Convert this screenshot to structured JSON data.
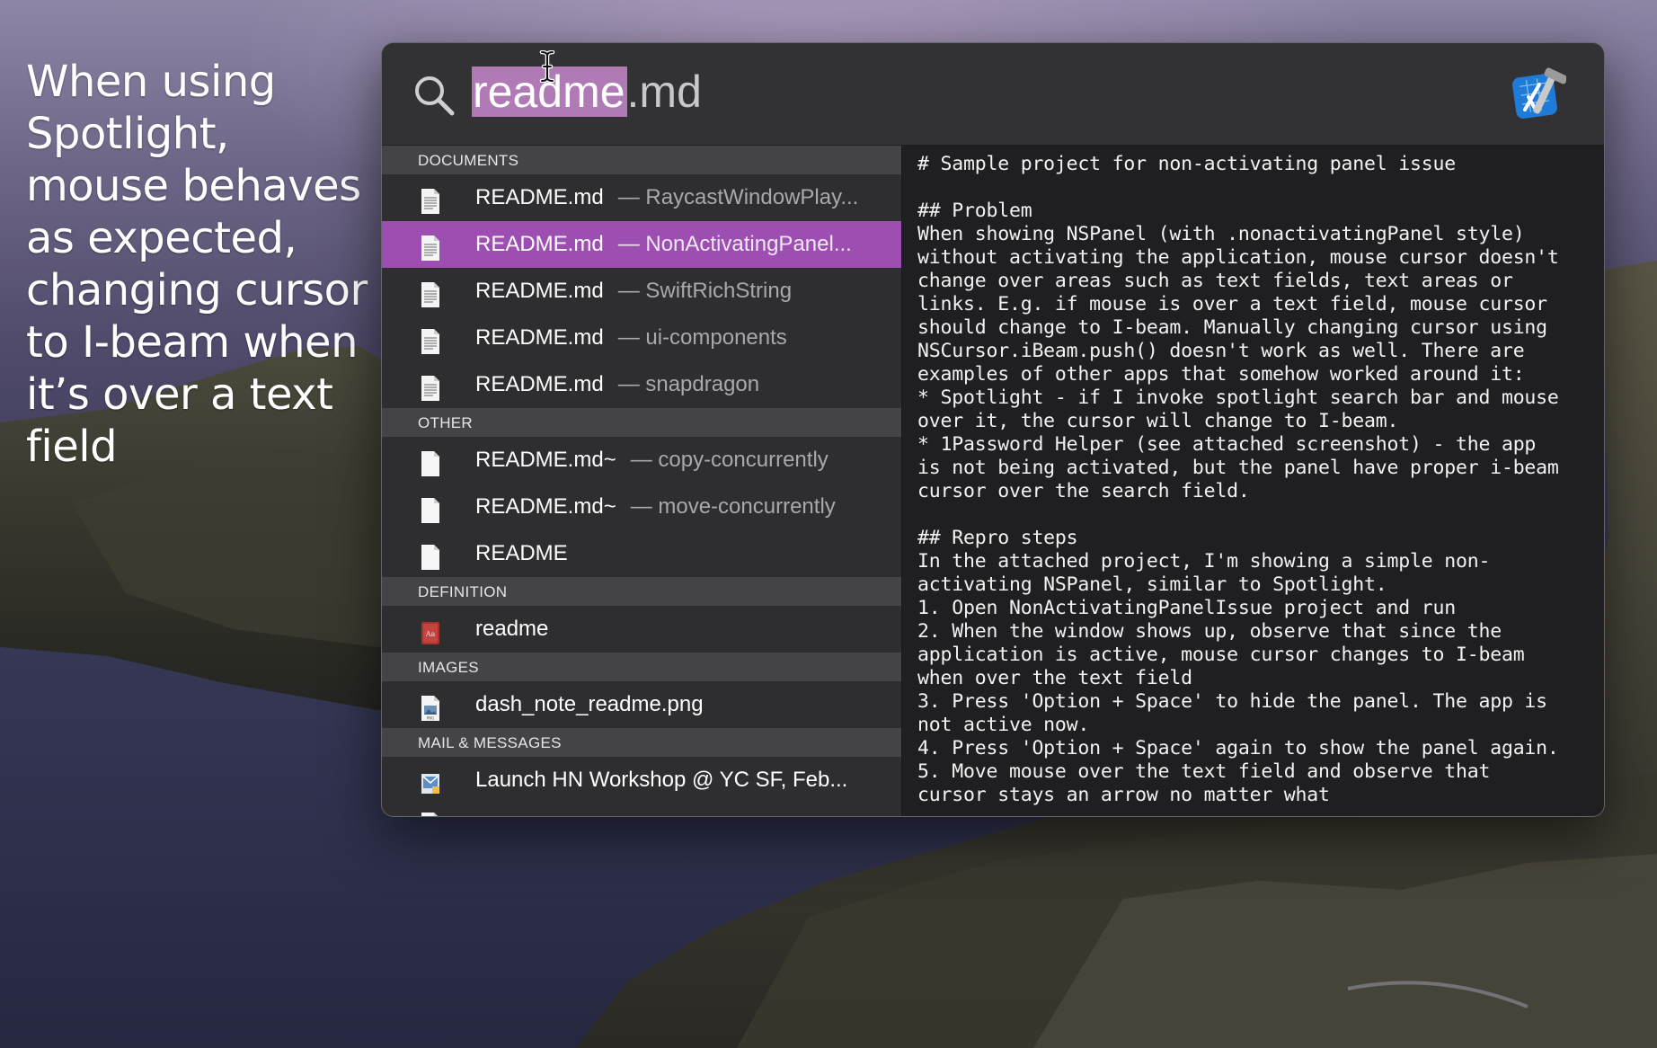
{
  "caption": "When using Spotlight, mouse behaves as expected, changing cursor to I-beam when it’s over a text field",
  "spotlight": {
    "query_selected": "readme",
    "query_rest": ".md",
    "sections": [
      {
        "header": "DOCUMENTS",
        "icon": "text-document-icon",
        "items": [
          {
            "name": "README.md",
            "path": "— RaycastWindowPlay...",
            "selected": false
          },
          {
            "name": "README.md",
            "path": "— NonActivatingPanel...",
            "selected": true
          },
          {
            "name": "README.md",
            "path": "— SwiftRichString",
            "selected": false
          },
          {
            "name": "README.md",
            "path": "— ui-components",
            "selected": false
          },
          {
            "name": "README.md",
            "path": "— snapdragon",
            "selected": false
          }
        ]
      },
      {
        "header": "OTHER",
        "icon": "blank-document-icon",
        "items": [
          {
            "name": "README.md~",
            "path": "— copy-concurrently",
            "selected": false
          },
          {
            "name": "README.md~",
            "path": "— move-concurrently",
            "selected": false
          },
          {
            "name": "README",
            "path": "",
            "selected": false
          }
        ]
      },
      {
        "header": "DEFINITION",
        "icon": "dictionary-icon",
        "items": [
          {
            "name": "readme",
            "path": "",
            "selected": false
          }
        ]
      },
      {
        "header": "IMAGES",
        "icon": "image-file-icon",
        "items": [
          {
            "name": "dash_note_readme.png",
            "path": "",
            "selected": false
          }
        ]
      },
      {
        "header": "MAIL & MESSAGES",
        "icon": "mail-message-icon",
        "items": [
          {
            "name": "Launch HN Workshop @ YC SF, Feb...",
            "path": "",
            "selected": false
          }
        ]
      }
    ],
    "preview_lines": [
      "# Sample project for non-activating panel issue",
      "",
      "## Problem",
      "When showing NSPanel (with .nonactivatingPanel style)",
      "without activating the application, mouse cursor doesn't",
      "change over areas such as text fields, text areas or",
      "links. E.g. if mouse is over a text field, mouse cursor",
      "should change to I-beam. Manually changing cursor using",
      "NSCursor.iBeam.push() doesn't work as well. There are",
      "examples of other apps that somehow worked around it:",
      "* Spotlight - if I invoke spotlight search bar and mouse",
      "over it, the cursor will change to I-beam.",
      "* 1Password Helper (see attached screenshot) - the app",
      "is not being activated, but the panel have proper i-beam",
      "cursor over the search field.",
      "",
      "## Repro steps",
      "In the attached project, I'm showing a simple non-",
      "activating NSPanel, similar to Spotlight.",
      "1. Open NonActivatingPanelIssue project and run",
      "2. When the window shows up, observe that since the",
      "application is active, mouse cursor changes to I-beam",
      "when over the text field",
      "3. Press 'Option + Space' to hide the panel. The app is",
      "not active now.",
      "4. Press 'Option + Space' again to show the panel again.",
      "5. Move mouse over the text field and observe that",
      "cursor stays an arrow no matter what"
    ]
  },
  "colors": {
    "selection_highlight": "#9c4fb0",
    "query_selection": "#b07bb4"
  }
}
